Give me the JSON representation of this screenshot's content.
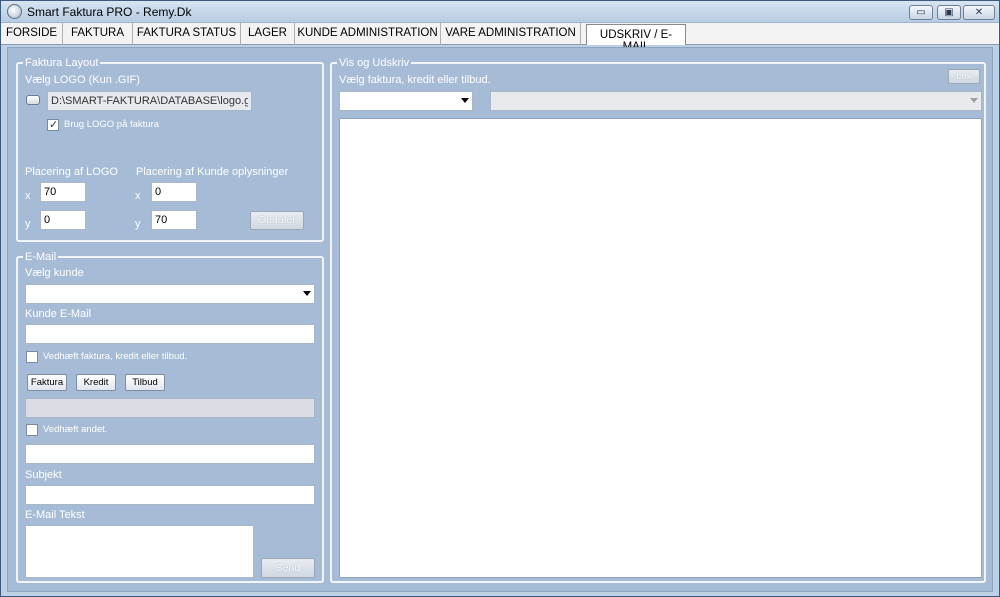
{
  "window": {
    "title": "Smart Faktura PRO  -  Remy.Dk",
    "minimize_glyph": "▭",
    "restore_glyph": "▣",
    "close_glyph": "✕"
  },
  "menu": {
    "tabs": [
      {
        "label": "FORSIDE"
      },
      {
        "label": "FAKTURA"
      },
      {
        "label": "FAKTURA STATUS"
      },
      {
        "label": "LAGER"
      },
      {
        "label": "KUNDE ADMINISTRATION"
      },
      {
        "label": "VARE ADMINISTRATION"
      },
      {
        "label": "UDSKRIV / E-MAIL"
      }
    ],
    "active_tab": "UDSKRIV / E-MAIL"
  },
  "layout_group": {
    "legend": "Faktura Layout",
    "logo_label": "Vælg LOGO (Kun .GIF)",
    "logo_path": "D:\\SMART-FAKTURA\\DATABASE\\logo.gif",
    "use_logo_label": "Brug LOGO på faktura",
    "use_logo_checked": true,
    "logo_pos_label": "Placering af LOGO",
    "customer_pos_label": "Placering af Kunde oplysninger",
    "x_label": "x",
    "y_label": "y",
    "logo_x": "70",
    "logo_y": "0",
    "customer_x": "0",
    "customer_y": "70",
    "update_button": "Opdater"
  },
  "email_group": {
    "legend": "E-Mail",
    "customer_label": "Vælg kunde",
    "customer_value": "",
    "email_label": "Kunde E-Mail",
    "email_value": "",
    "attach_invoice_label": "Vedhæft faktura, kredit eller tilbud.",
    "attach_invoice_checked": false,
    "buttons": {
      "invoice": "Faktura",
      "credit": "Kredit",
      "offer": "Tilbud"
    },
    "attach_file_value": "",
    "attach_other_label": "Vedhæft andet.",
    "attach_other_checked": false,
    "other_value": "",
    "subject_label": "Subjekt",
    "subject_value": "",
    "body_label": "E-Mail Tekst",
    "body_value": "",
    "send_button": "Send"
  },
  "preview_group": {
    "legend": "Vis og Udskriv",
    "select_label": "Vælg faktura, kredit eller tilbud.",
    "type_value": "",
    "document_value": "",
    "close_button": "Luk"
  }
}
